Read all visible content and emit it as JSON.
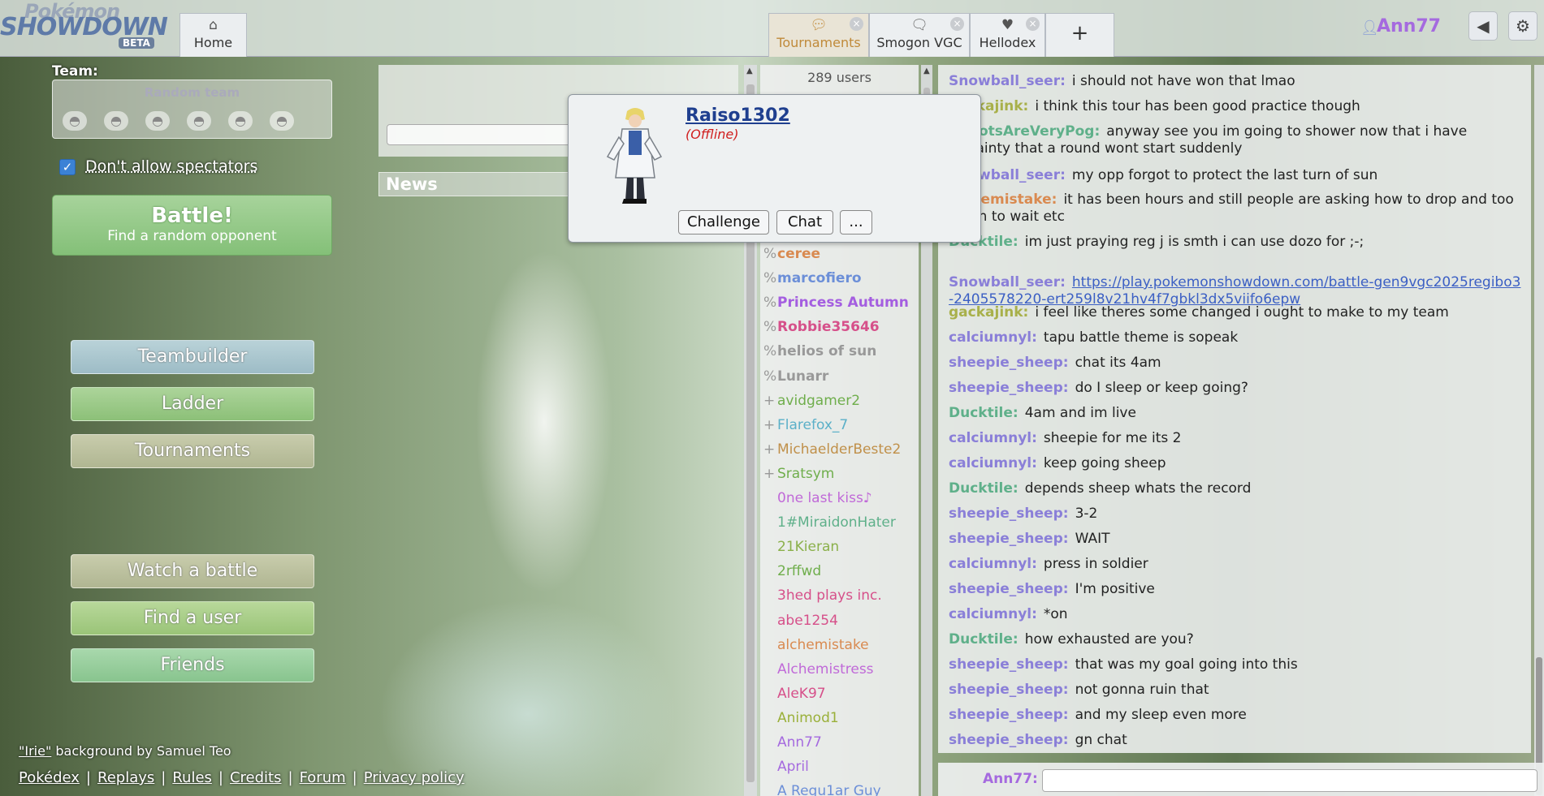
{
  "logo": {
    "line1": "Pokémon",
    "line2": "SHOWDOWN",
    "badge": "BETA"
  },
  "header": {
    "home_tab": "Home",
    "tabs": [
      {
        "label": "Tournaments",
        "icon": "chat-bubble-icon",
        "active": true
      },
      {
        "label": "Smogon VGC",
        "icon": "chat-bubble-icon",
        "active": false
      },
      {
        "label": "Hellodex",
        "icon": "heart-icon",
        "active": false
      }
    ],
    "new_tab_symbol": "+",
    "close_symbol": "×",
    "username": "Ann77",
    "user_color": "#a56adf",
    "sound_icon": "◀",
    "settings_icon": "⚙"
  },
  "left": {
    "team_label": "Team:",
    "team_value": "Random team",
    "spectators_label": "Don't allow spectators",
    "spectators_checked": true,
    "battle_title": "Battle!",
    "battle_subtitle": "Find a random opponent",
    "menu": {
      "teambuilder": "Teambuilder",
      "ladder": "Ladder",
      "tournaments": "Tournaments",
      "watch": "Watch a battle",
      "find_user": "Find a user",
      "friends": "Friends"
    },
    "background_credit": {
      "title": "\"Irie\"",
      "rest": " background by Samuel Teo"
    },
    "footer_links": [
      "Pokédex",
      "Replays",
      "Rules",
      "Credits",
      "Forum",
      "Privacy policy"
    ],
    "footer_sep": "|"
  },
  "middle": {
    "news_label": "News"
  },
  "userlist": {
    "count": "289 users",
    "users": [
      {
        "rank": "%",
        "name": "ceree",
        "color": "#d98a50",
        "bold": true
      },
      {
        "rank": "%",
        "name": "marcofiero",
        "color": "#6c8fd8",
        "bold": true
      },
      {
        "rank": "%",
        "name": "Princess Autumn",
        "color": "#a45ee0",
        "bold": true
      },
      {
        "rank": "%",
        "name": "Robbie35646",
        "color": "#d6508a",
        "bold": true
      },
      {
        "rank": "%",
        "name": "helios of sun",
        "color": "#999999",
        "bold": true
      },
      {
        "rank": "%",
        "name": "Lunarr",
        "color": "#999999",
        "bold": true
      },
      {
        "rank": "+",
        "name": "avidgamer2",
        "color": "#6fae4c",
        "bold": false
      },
      {
        "rank": "+",
        "name": "Flarefox_7",
        "color": "#5bb0c8",
        "bold": false
      },
      {
        "rank": "+",
        "name": "MichaelderBeste2",
        "color": "#c0904a",
        "bold": false
      },
      {
        "rank": "+",
        "name": "Sratsym",
        "color": "#6fae4c",
        "bold": false
      },
      {
        "rank": "",
        "name": "0ne last kiss♪",
        "color": "#c06ad8",
        "bold": false
      },
      {
        "rank": "",
        "name": "1#MiraidonHater",
        "color": "#5fb08a",
        "bold": false
      },
      {
        "rank": "",
        "name": "21Kieran",
        "color": "#8ab04a",
        "bold": false
      },
      {
        "rank": "",
        "name": "2rffwd",
        "color": "#6fae4c",
        "bold": false
      },
      {
        "rank": "",
        "name": "3hed plays inc.",
        "color": "#d6508a",
        "bold": false
      },
      {
        "rank": "",
        "name": "abe1254",
        "color": "#d6508a",
        "bold": false
      },
      {
        "rank": "",
        "name": "alchemistake",
        "color": "#d98a50",
        "bold": false
      },
      {
        "rank": "",
        "name": "Alchemistress",
        "color": "#c06ad8",
        "bold": false
      },
      {
        "rank": "",
        "name": "AleK97",
        "color": "#d6508a",
        "bold": false
      },
      {
        "rank": "",
        "name": "Animod1",
        "color": "#9ab03a",
        "bold": false
      },
      {
        "rank": "",
        "name": "Ann77",
        "color": "#a56adf",
        "bold": false
      },
      {
        "rank": "",
        "name": "April",
        "color": "#a56adf",
        "bold": false
      },
      {
        "rank": "",
        "name": "A Regu1ar Guy",
        "color": "#6c8fd8",
        "bold": false
      }
    ]
  },
  "chat": {
    "messages": [
      {
        "user": "Snowball_seer:",
        "color": "#8a7fd8",
        "text": "i should not have won that lmao"
      },
      {
        "user": "gackajink:",
        "color": "#a8b04a",
        "text": "i think this tour has been good practice though"
      },
      {
        "user": "RobotsAreVeryPog:",
        "color": "#5fb08a",
        "text": "anyway see you im going to shower now that i have certainty that a round wont start suddenly"
      },
      {
        "user": "Snowball_seer:",
        "color": "#8a7fd8",
        "text": "my opp forgot to protect the last turn of sun"
      },
      {
        "user": "alchemistake:",
        "color": "#d98a50",
        "text": "it has been hours and still people are asking how to drop and too much to wait etc"
      },
      {
        "user": "Ducktile:",
        "color": "#5fb08a",
        "text": "im just praying reg j is smth i can use dozo for ;-;"
      },
      {
        "user": "Snowball_seer:",
        "color": "#8a7fd8",
        "text": "",
        "link": "https://play.pokemonshowdown.com/battle-gen9vgc2025regibo3-2405578220-ert259l8v21hv4f7gbkl3dx5viifo6epw"
      },
      {
        "user": "gackajink:",
        "color": "#a8b04a",
        "text": "i feel like theres some changed i ought to make to my team"
      },
      {
        "user": "calciumnyl:",
        "color": "#8a7fd8",
        "text": "tapu battle theme is sopeak"
      },
      {
        "user": "sheepie_sheep:",
        "color": "#8a7fd8",
        "text": "chat its 4am"
      },
      {
        "user": "sheepie_sheep:",
        "color": "#8a7fd8",
        "text": "do I sleep or keep going?"
      },
      {
        "user": "Ducktile:",
        "color": "#5fb08a",
        "text": "4am and im live"
      },
      {
        "user": "calciumnyl:",
        "color": "#8a7fd8",
        "text": "sheepie for me its 2"
      },
      {
        "user": "calciumnyl:",
        "color": "#8a7fd8",
        "text": "keep going sheep"
      },
      {
        "user": "Ducktile:",
        "color": "#5fb08a",
        "text": "depends sheep whats the record"
      },
      {
        "user": "sheepie_sheep:",
        "color": "#8a7fd8",
        "text": "3-2"
      },
      {
        "user": "sheepie_sheep:",
        "color": "#8a7fd8",
        "text": "WAIT"
      },
      {
        "user": "calciumnyl:",
        "color": "#8a7fd8",
        "text": "press in soldier"
      },
      {
        "user": "sheepie_sheep:",
        "color": "#8a7fd8",
        "text": "I'm positive"
      },
      {
        "user": "calciumnyl:",
        "color": "#8a7fd8",
        "text": "*on"
      },
      {
        "user": "Ducktile:",
        "color": "#5fb08a",
        "text": "how exhausted are you?"
      },
      {
        "user": "sheepie_sheep:",
        "color": "#8a7fd8",
        "text": "that was my goal going into this"
      },
      {
        "user": "sheepie_sheep:",
        "color": "#8a7fd8",
        "text": "not gonna ruin that"
      },
      {
        "user": "sheepie_sheep:",
        "color": "#8a7fd8",
        "text": "and my sleep even more"
      },
      {
        "user": "sheepie_sheep:",
        "color": "#8a7fd8",
        "text": "gn chat"
      }
    ],
    "input_user": "Ann77:"
  },
  "popup": {
    "name": "Raiso1302",
    "status": "(Offline)",
    "challenge": "Challenge",
    "chat": "Chat",
    "more": "..."
  }
}
